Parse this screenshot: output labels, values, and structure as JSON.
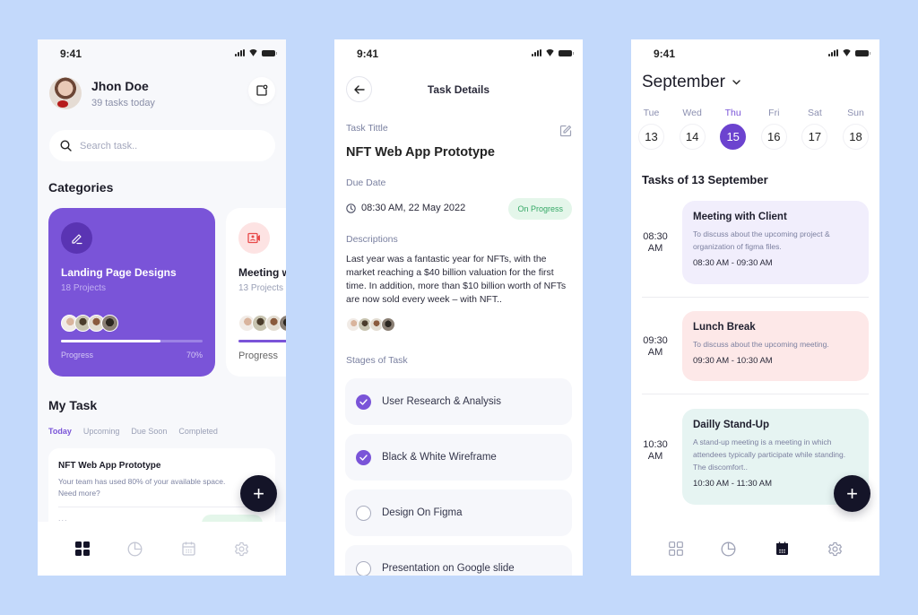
{
  "colors": {
    "background": "#c3d9fb",
    "accent": "#7a54d8",
    "success": "#35a866",
    "fab": "#141428"
  },
  "status_bar": {
    "time": "9:41"
  },
  "home": {
    "user": {
      "name": "Jhon Doe",
      "subtitle": "39 tasks today"
    },
    "search": {
      "placeholder": "Search task.."
    },
    "categories_title": "Categories",
    "categories": [
      {
        "title": "Landing Page Designs",
        "subtitle": "18 Projects",
        "progress_label": "Progress",
        "progress_value": "70%",
        "progress_fraction": 0.7,
        "icon": "pen-icon"
      },
      {
        "title": "Meeting with Client",
        "subtitle": "13 Projects",
        "progress_label": "Progress",
        "progress_value": "",
        "progress_fraction": 1.0,
        "icon": "video-call-icon"
      }
    ],
    "my_task_title": "My Task",
    "tabs": [
      "Today",
      "Upcoming",
      "Due Soon",
      "Completed"
    ],
    "active_tab": "Today",
    "task_card": {
      "title": "NFT Web App Prototype",
      "description": "Your team has used 80% of your available space. Need more?",
      "dots": "..."
    },
    "fab_label": "+",
    "nav": [
      "dashboard-icon",
      "chart-icon",
      "calendar-icon",
      "settings-icon"
    ],
    "active_nav": "dashboard-icon"
  },
  "details": {
    "header_title": "Task Details",
    "title_label": "Task Tittle",
    "task_title": "NFT Web App Prototype",
    "due_label": "Due Date",
    "due_value": "08:30 AM, 22 May 2022",
    "status": "On Progress",
    "desc_label": "Descriptions",
    "description": "Last year was a fantastic year for NFTs, with the market reaching a $40 billion valuation for the first time. In addition, more than $10 billion worth of NFTs are now sold every week – with NFT..",
    "stages_label": "Stages of Task",
    "stages": [
      {
        "label": "User Research & Analysis",
        "done": true
      },
      {
        "label": "Black & White Wireframe",
        "done": true
      },
      {
        "label": "Design On Figma",
        "done": false
      },
      {
        "label": "Presentation on Google slide",
        "done": false
      }
    ]
  },
  "calendar": {
    "month": "September",
    "days": [
      {
        "name": "Tue",
        "date": "13"
      },
      {
        "name": "Wed",
        "date": "14"
      },
      {
        "name": "Thu",
        "date": "15",
        "selected": true
      },
      {
        "name": "Fri",
        "date": "16"
      },
      {
        "name": "Sat",
        "date": "17"
      },
      {
        "name": "Sun",
        "date": "18"
      }
    ],
    "tasks_heading": "Tasks of 13 September",
    "events": [
      {
        "slot": "08:30\nAM",
        "slot_top": "08:30",
        "slot_bottom": "AM",
        "title": "Meeting with Client",
        "description": "To discuss about the upcoming project & organization of figma files.",
        "range": "08:30 AM - 09:30 AM",
        "color": "#f1eefc"
      },
      {
        "slot_top": "09:30",
        "slot_bottom": "AM",
        "title": "Lunch Break",
        "description": "To discuss about the upcoming meeting.",
        "range": "09:30 AM - 10:30 AM",
        "color": "#fde8e8"
      },
      {
        "slot_top": "10:30",
        "slot_bottom": "AM",
        "title": "Dailly Stand-Up",
        "description": "A stand-up meeting is a meeting in which attendees typically participate while standing. The discomfort..",
        "range": "10:30 AM - 11:30 AM",
        "color": "#e6f4f2"
      }
    ],
    "fab_label": "+",
    "active_nav": "calendar-icon"
  }
}
